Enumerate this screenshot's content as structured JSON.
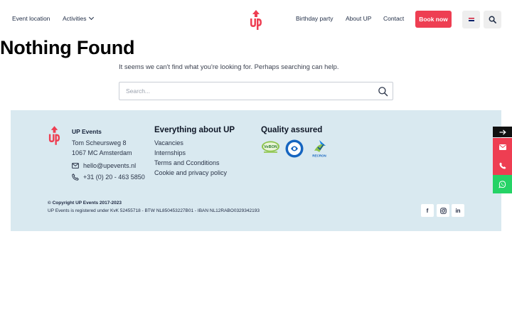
{
  "header": {
    "nav_left": [
      "Event location",
      "Activities"
    ],
    "nav_right": [
      "Birthday party",
      "About UP",
      "Contact"
    ],
    "book_label": "Book now",
    "flag_icon": "uk-flag-icon",
    "search_icon": "search-icon"
  },
  "main": {
    "title": "Nothing Found",
    "subtitle": "It seems we can't find what you're looking for. Perhaps searching can help.",
    "search_placeholder": "Search..."
  },
  "footer": {
    "company": "UP Events",
    "address_line1": "Tom Scheursweg 8",
    "address_line2": "1067 MC Amsterdam",
    "email": "hello@upevents.nl",
    "phone": "+31 (0) 20 - 463 5850",
    "about_heading": "Everything about UP",
    "about_links": [
      "Vacancies",
      "Internships",
      "Terms and Cconditions",
      "Cookie and privacy policy"
    ],
    "quality_heading": "Quality assured",
    "badges": [
      "VeBON",
      "RECRON"
    ],
    "copyright": "© Copyright UP Events 2017-2023",
    "registration": "UP Events is registered under KvK 52455718 - BTW NL850453227B01 - IBAN NL12RABO0329342193",
    "social": [
      {
        "icon": "facebook-icon",
        "glyph": "f"
      },
      {
        "icon": "instagram-icon",
        "glyph": ""
      },
      {
        "icon": "linkedin-icon",
        "glyph": "in"
      }
    ]
  },
  "side_buttons": [
    {
      "icon": "arrow-right-icon",
      "color": "#111111"
    },
    {
      "icon": "envelope-icon",
      "color": "#ee3e52"
    },
    {
      "icon": "phone-icon",
      "color": "#ee3e52"
    },
    {
      "icon": "whatsapp-icon",
      "color": "#25d366"
    }
  ],
  "colors": {
    "accent": "#ee3e52",
    "footer_bg": "#d9e9f0",
    "nav_text": "#1f2c45"
  }
}
